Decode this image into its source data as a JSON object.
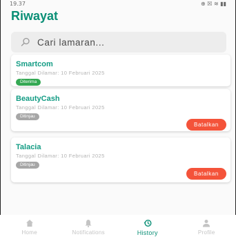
{
  "status_bar": {
    "time": "19.37",
    "icons_right": "⊕ ☒ ≋ ▮▮"
  },
  "page": {
    "title": "Riwayat"
  },
  "search": {
    "placeholder": "Cari lamaran..."
  },
  "applications": [
    {
      "company": "Smartcom",
      "date": "Tanggal Dilamar: 10 Februari 2025",
      "status": "Diterima",
      "status_color": "#34a853",
      "action": ""
    },
    {
      "company": "BeautyCash",
      "date": "Tanggal Dilamar: 10 Februari 2025",
      "status": "Ditinjau",
      "status_color": "#a6a6a6",
      "action": "Batalkan"
    },
    {
      "company": "Talacia",
      "date": "Tanggal Dilamar: 10 Februari 2025",
      "status": "Ditinjau",
      "status_color": "#a6a6a6",
      "action": "Batalkan"
    }
  ],
  "nav": [
    {
      "label": "Home",
      "icon": "home-icon",
      "active": false
    },
    {
      "label": "Notifications",
      "icon": "bell-icon",
      "active": false
    },
    {
      "label": "History",
      "icon": "history-icon",
      "active": true
    },
    {
      "label": "Profile",
      "icon": "profile-icon",
      "active": false
    }
  ],
  "colors": {
    "accent": "#0a8f76",
    "danger": "#f4533a",
    "success": "#34a853",
    "pending": "#a6a6a6"
  }
}
